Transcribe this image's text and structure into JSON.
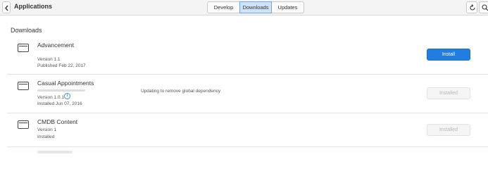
{
  "header": {
    "title": "Applications",
    "tabs": [
      {
        "label": "Develop",
        "active": false
      },
      {
        "label": "Downloads",
        "active": true
      },
      {
        "label": "Updates",
        "active": false
      }
    ],
    "accent_color": "#1f7ee0"
  },
  "main": {
    "section_title": "Downloads",
    "apps": [
      {
        "name": "Advancement",
        "version": "Version 1.1",
        "date": "Published Feb 22, 2017",
        "action_label": "Install",
        "action_enabled": true,
        "status": ""
      },
      {
        "name": "Casual Appointments",
        "version": "Version 1.0.1",
        "date": "Installed Jun 07, 2016",
        "action_label": "Installed",
        "action_enabled": false,
        "status": "Updating to remove global dependency"
      },
      {
        "name": "CMDB Content",
        "version": "Version 1",
        "date": "Installed",
        "action_label": "Installed",
        "action_enabled": false,
        "status": ""
      }
    ]
  },
  "icons": {
    "back": "chevron-left-icon",
    "refresh": "refresh-icon",
    "search": "search-icon",
    "app": "app-window-icon",
    "info": "info-icon"
  }
}
